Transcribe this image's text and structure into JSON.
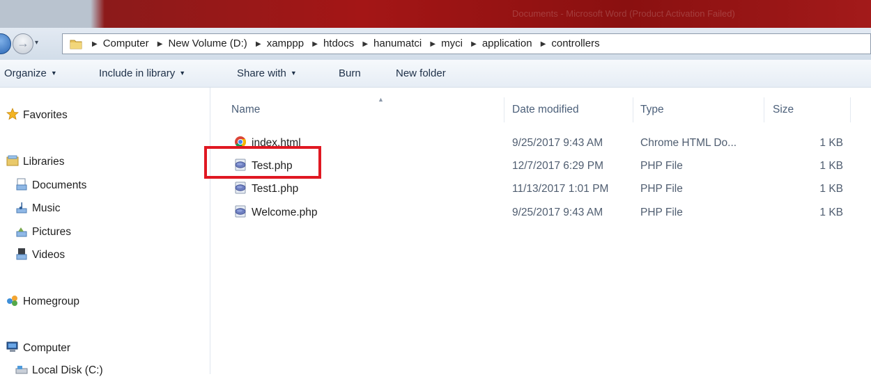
{
  "window": {
    "title": "Documents - Microsoft Word (Product Activation Failed)"
  },
  "nav_buttons": {
    "forward_glyph": "→",
    "recent_glyph": "▾"
  },
  "address": {
    "separator": "▶",
    "breadcrumb": [
      "Computer",
      "New Volume (D:)",
      "xamppp",
      "htdocs",
      "hanumatci",
      "myci",
      "application",
      "controllers"
    ]
  },
  "toolbar": {
    "caret": "▼",
    "organize": "Organize",
    "include_in_library": "Include in library",
    "share_with": "Share with",
    "burn": "Burn",
    "new_folder": "New folder"
  },
  "nav_pane": {
    "favorites": "Favorites",
    "libraries": "Libraries",
    "documents": "Documents",
    "music": "Music",
    "pictures": "Pictures",
    "videos": "Videos",
    "homegroup": "Homegroup",
    "computer": "Computer",
    "local_disk": "Local Disk (C:)"
  },
  "columns": {
    "name": "Name",
    "date_modified": "Date modified",
    "type": "Type",
    "size": "Size",
    "sort_glyph": "▲"
  },
  "files": [
    {
      "name": "index.html",
      "icon": "chrome-icon",
      "date": "9/25/2017 9:43 AM",
      "type": "Chrome HTML Do...",
      "size": "1 KB"
    },
    {
      "name": "Test.php",
      "icon": "php-file-icon",
      "date": "12/7/2017 6:29 PM",
      "type": "PHP File",
      "size": "1 KB"
    },
    {
      "name": "Test1.php",
      "icon": "php-file-icon",
      "date": "11/13/2017 1:01 PM",
      "type": "PHP File",
      "size": "1 KB"
    },
    {
      "name": "Welcome.php",
      "icon": "php-file-icon",
      "date": "9/25/2017 9:43 AM",
      "type": "PHP File",
      "size": "1 KB"
    }
  ],
  "colors": {
    "highlight": "#e01822",
    "titlebar": "#a41616",
    "column_header": "#4c607a"
  }
}
